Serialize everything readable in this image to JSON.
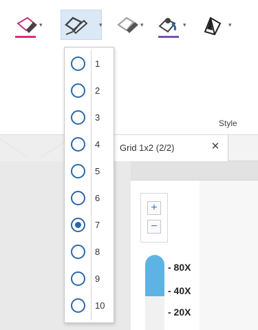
{
  "ribbon": {
    "group_label": "Style",
    "tools": [
      {
        "icon": "pen-color-icon",
        "underline_color": "#e2267d"
      },
      {
        "icon": "line-thickness-icon",
        "active": true
      },
      {
        "icon": "highlighter-icon"
      },
      {
        "icon": "fill-color-icon",
        "underline_color": "#7b4fb6"
      },
      {
        "icon": "transparency-icon"
      }
    ],
    "dropdown_arrow": "▾"
  },
  "line_width_menu": {
    "options": [
      "1",
      "2",
      "3",
      "4",
      "5",
      "6",
      "7",
      "8",
      "9",
      "10"
    ],
    "selected": "7"
  },
  "tabs": {
    "active_label": "Grid 1x2 (2/2)",
    "close_glyph": "✕"
  },
  "viewer": {
    "zoom_in_glyph": "+",
    "zoom_out_glyph": "−",
    "magnification_labels": [
      "- 80X",
      "- 40X",
      "- 20X"
    ],
    "magnification_fill_fraction": 0.55,
    "accent_color": "#5db4e4"
  }
}
